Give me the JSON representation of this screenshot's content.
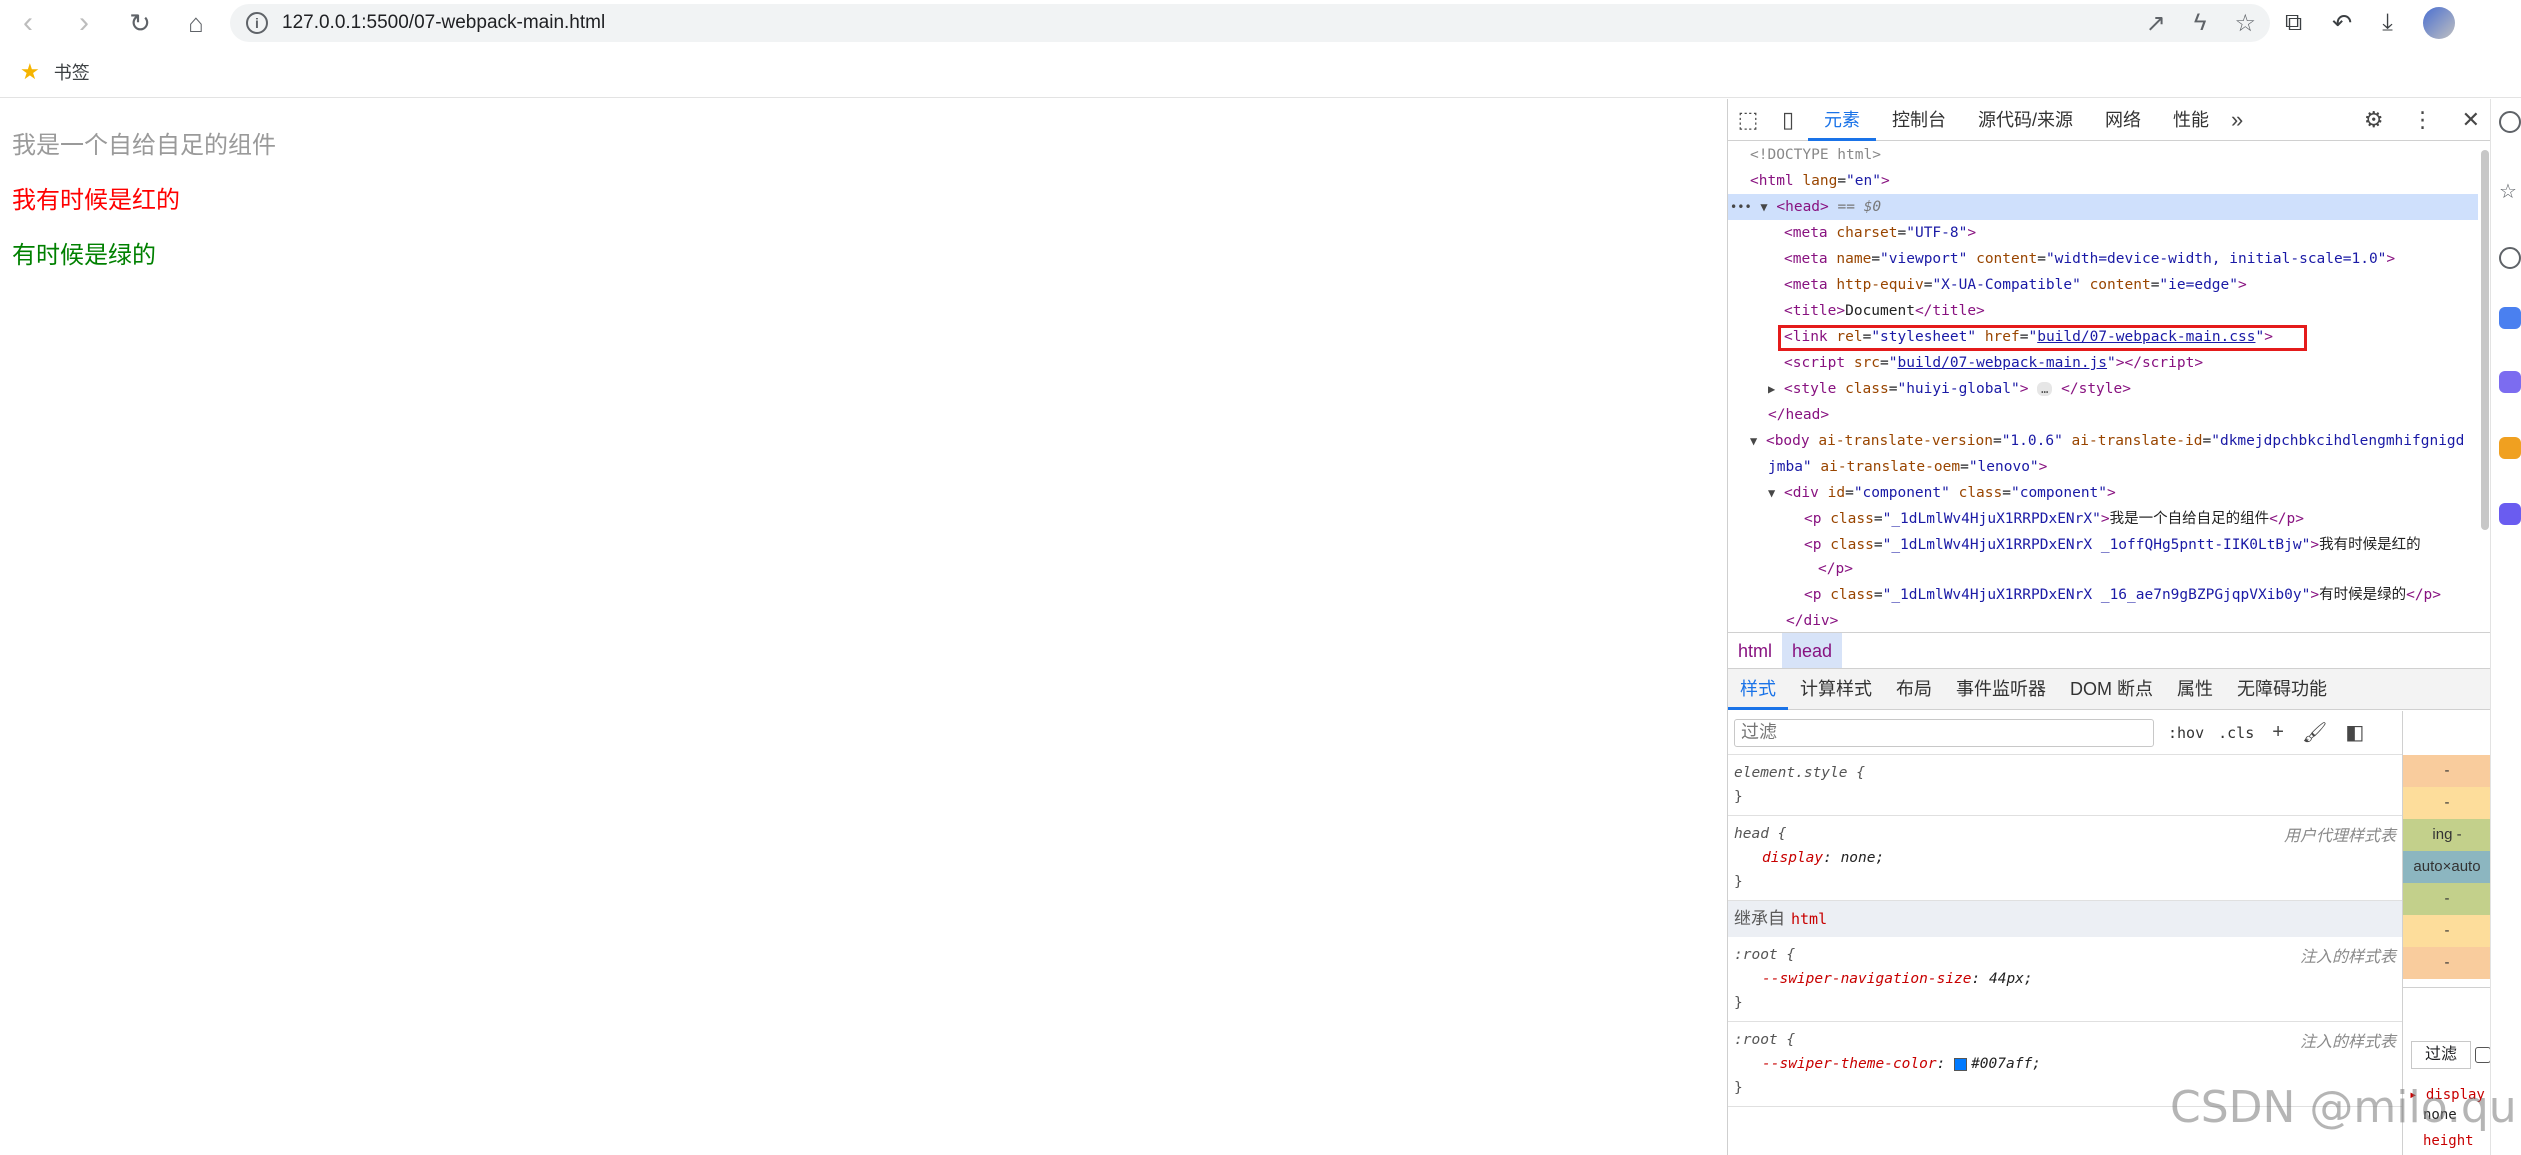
{
  "browser": {
    "url": "127.0.0.1:5500/07-webpack-main.html",
    "bookmark_label": "书签"
  },
  "page": {
    "paragraphs": [
      "我是一个自给自足的组件",
      "我有时候是红的",
      "有时候是绿的"
    ],
    "colors": {
      "gray": "#9a9a9a",
      "red": "#ff0000",
      "green": "#008000"
    }
  },
  "devtools": {
    "tabs": [
      "元素",
      "控制台",
      "源代码/来源",
      "网络",
      "性能"
    ],
    "active_tab": "元素",
    "elements": {
      "doctype": "<!DOCTYPE html>",
      "html_open": {
        "tag": "<html",
        "attr": "lang",
        "val": "\"en\"",
        "close": ">"
      },
      "head_open": "<head>",
      "selected_marker": "== $0",
      "meta_charset": {
        "attr": "charset",
        "val": "\"UTF-8\""
      },
      "meta_viewport": {
        "name_val": "\"viewport\"",
        "content_val": "\"width=device-width, initial-scale=1.0\""
      },
      "meta_http": {
        "equiv_val": "\"X-UA-Compatible\"",
        "content_val": "\"ie=edge\""
      },
      "title_text": "Document",
      "link": {
        "rel_val": "\"stylesheet\"",
        "href": "build/07-webpack-main.css"
      },
      "script": {
        "src": "build/07-webpack-main.js"
      },
      "style_class": "\"huiyi-global\"",
      "head_close": "</head>",
      "body": {
        "ver": "\"1.0.6\"",
        "id": "\"dkmejdpchbkcihdlengmhifgnigd",
        "id_cont": "jmba\"",
        "oem": "\"lenovo\""
      },
      "div": {
        "id": "\"component\"",
        "class": "\"component\""
      },
      "p1": {
        "class": "\"_1dLmlWv4HjuX1RRPDxENrX\"",
        "text": "我是一个自给自足的组件"
      },
      "p2": {
        "class": "\"_1dLmlWv4HjuX1RRPDxENrX _1offQHg5pntt-IIK0LtBjw\"",
        "text": "我有时候是红的"
      },
      "p3": {
        "class": "\"_1dLmlWv4HjuX1RRPDxENrX _16_ae7n9gBZPGjqpVXib0y\"",
        "text": "有时候是绿的"
      },
      "p_close": "</p>",
      "div_close": "</div>"
    },
    "breadcrumbs": [
      "html",
      "head"
    ],
    "sub_tabs": [
      "样式",
      "计算样式",
      "布局",
      "事件监听器",
      "DOM 断点",
      "属性",
      "无障碍功能"
    ],
    "styles": {
      "filter_placeholder": "过滤",
      "hov": ":hov",
      "cls": ".cls",
      "element_style": "element.style {",
      "head_rule": {
        "selector": "head {",
        "source": "用户代理样式表",
        "prop": "display",
        "value": "none;"
      },
      "inherited_label": "继承自",
      "inherited_tag": "html",
      "root1": {
        "selector": ":root {",
        "source": "注入的样式表",
        "prop": "--swiper-navigation-size",
        "value": "44px;"
      },
      "root2": {
        "selector": ":root {",
        "source": "注入的样式表",
        "prop": "--swiper-theme-color",
        "value": "#007aff;"
      },
      "close_brace": "}"
    },
    "box_model": {
      "rows": [
        "-",
        "-",
        "ing  -",
        "auto×auto",
        "-",
        "-",
        "-"
      ],
      "filter": "过滤",
      "computed_prop": "display",
      "computed_val": "none",
      "computed_prop2": "height"
    }
  },
  "watermark": "CSDN @milo.qu"
}
